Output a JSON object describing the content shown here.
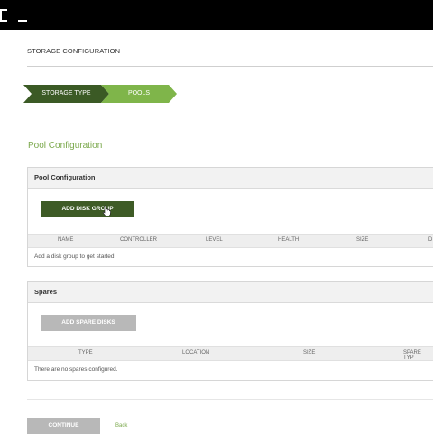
{
  "header": {
    "title": "STORAGE CONFIGURATION"
  },
  "wizard": {
    "steps": [
      {
        "label": "STORAGE TYPE",
        "color": "#3b5a25",
        "state": "done"
      },
      {
        "label": "POOLS",
        "color": "#7fb54a",
        "state": "current"
      }
    ]
  },
  "main": {
    "section_title": "Pool Configuration",
    "pool_panel": {
      "title": "Pool Configuration",
      "add_button": "ADD DISK GROUP",
      "columns": [
        "NAME",
        "CONTROLLER",
        "LEVEL",
        "HEALTH",
        "SIZE",
        "D"
      ],
      "empty_text": "Add a disk group to get started."
    },
    "spares_panel": {
      "title": "Spares",
      "add_button": "ADD SPARE DISKS",
      "columns": [
        "TYPE",
        "LOCATION",
        "SIZE",
        "SPARE TYP"
      ],
      "empty_text": "There are no spares configured."
    }
  },
  "footer": {
    "continue_label": "CONTINUE",
    "back_label": "Back"
  },
  "colors": {
    "accent": "#7aa84b",
    "dark_green": "#3e5b26",
    "disabled": "#b8b8b8"
  }
}
